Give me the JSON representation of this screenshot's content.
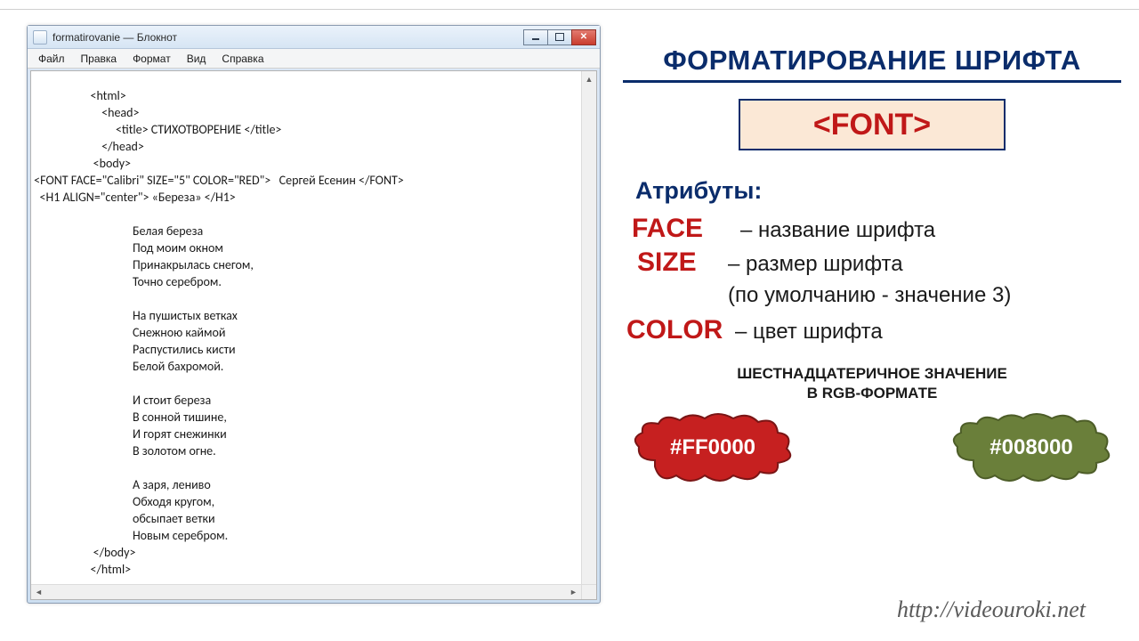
{
  "notepad": {
    "title": "formatirovanie — Блокнот",
    "menu": [
      "Файл",
      "Правка",
      "Формат",
      "Вид",
      "Справка"
    ],
    "content": "                     <html>\n                         <head>\n                              <title> СТИХОТВОРЕНИЕ </title>\n                         </head>\n                      <body>\n <FONT FACE=\"Calibri\" SIZE=\"5\" COLOR=\"RED\">   Сергей Есенин </FONT>\n   <H1 ALIGN=\"center\"> «Береза» </H1>\n\n                                    Белая береза\n                                    Под моим окном\n                                    Принакрылась снегом,\n                                    Точно серебром.\n\n                                    На пушистых ветках\n                                    Снежною каймой\n                                    Распустились кисти\n                                    Белой бахромой.\n\n                                    И стоит береза\n                                    В сонной тишине,\n                                    И горят снежинки\n                                    В золотом огне.\n\n                                    А заря, лениво\n                                    Обходя кругом,\n                                    обсыпает ветки\n                                    Новым серебром.\n                      </body>\n                     </html>"
  },
  "right": {
    "heading": "ФОРМАТИРОВАНИЕ ШРИФТА",
    "tag": "<FONT>",
    "attrs_title": "Атрибуты:",
    "face": {
      "name": "FACE",
      "desc": "– название шрифта"
    },
    "size": {
      "name": "SIZE",
      "desc": "– размер шрифта",
      "note": "(по умолчанию - значение 3)"
    },
    "color": {
      "name": "COLOR",
      "desc": "– цвет шрифта"
    },
    "hex_title1": "ШЕСТНАДЦАТЕРИЧНОЕ  ЗНАЧЕНИЕ",
    "hex_title2": "В RGB-ФОРМАТЕ",
    "cloud_red": "#FF0000",
    "cloud_green": "#008000"
  },
  "footer": "http://videouroki.net",
  "colors": {
    "navy": "#0a2c6b",
    "red": "#c01818",
    "cloud_red_fill": "#c62020",
    "cloud_green_fill": "#6a7f3a"
  }
}
